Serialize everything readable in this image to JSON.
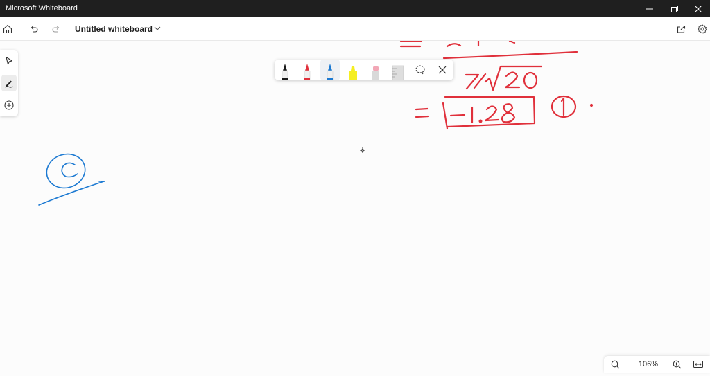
{
  "window": {
    "app_title": "Microsoft Whiteboard",
    "minimize_icon": "minimize-icon",
    "restore_icon": "restore-icon",
    "close_icon": "close-icon"
  },
  "toolbar": {
    "home_icon": "home-icon",
    "undo_icon": "undo-icon",
    "redo_icon": "redo-icon",
    "document_title": "Untitled whiteboard",
    "title_chevron_icon": "chevron-down-icon",
    "share_icon": "share-icon",
    "settings_icon": "gear-icon"
  },
  "left_rail": {
    "items": [
      {
        "name": "select",
        "icon": "pointer-icon",
        "active": false
      },
      {
        "name": "inking",
        "icon": "pen-icon",
        "active": true
      },
      {
        "name": "create",
        "icon": "add-circle-icon",
        "active": false
      }
    ]
  },
  "pen_tray": {
    "tools": [
      {
        "name": "black-pen",
        "color": "#1a1a1a",
        "active": false
      },
      {
        "name": "red-pen",
        "color": "#e0303b",
        "active": false
      },
      {
        "name": "blue-pen",
        "color": "#1d7ad2",
        "active": true
      },
      {
        "name": "highlighter",
        "color": "#f5ee22",
        "active": false
      },
      {
        "name": "eraser",
        "color": "#f2a7b6",
        "active": false
      },
      {
        "name": "ruler",
        "color": "#bdbdbd",
        "active": false
      }
    ],
    "lasso_icon": "lasso-icon",
    "close_icon": "close-icon"
  },
  "canvas": {
    "ink_colors": {
      "red": "#e0303b",
      "blue": "#1d7ad2"
    },
    "visible_ink_text": [
      "7",
      "20",
      "=",
      "-1.28",
      "1"
    ]
  },
  "zoom": {
    "zoom_out_icon": "zoom-out-icon",
    "level": "106%",
    "zoom_in_icon": "zoom-in-icon",
    "fit_icon": "fit-width-icon"
  }
}
